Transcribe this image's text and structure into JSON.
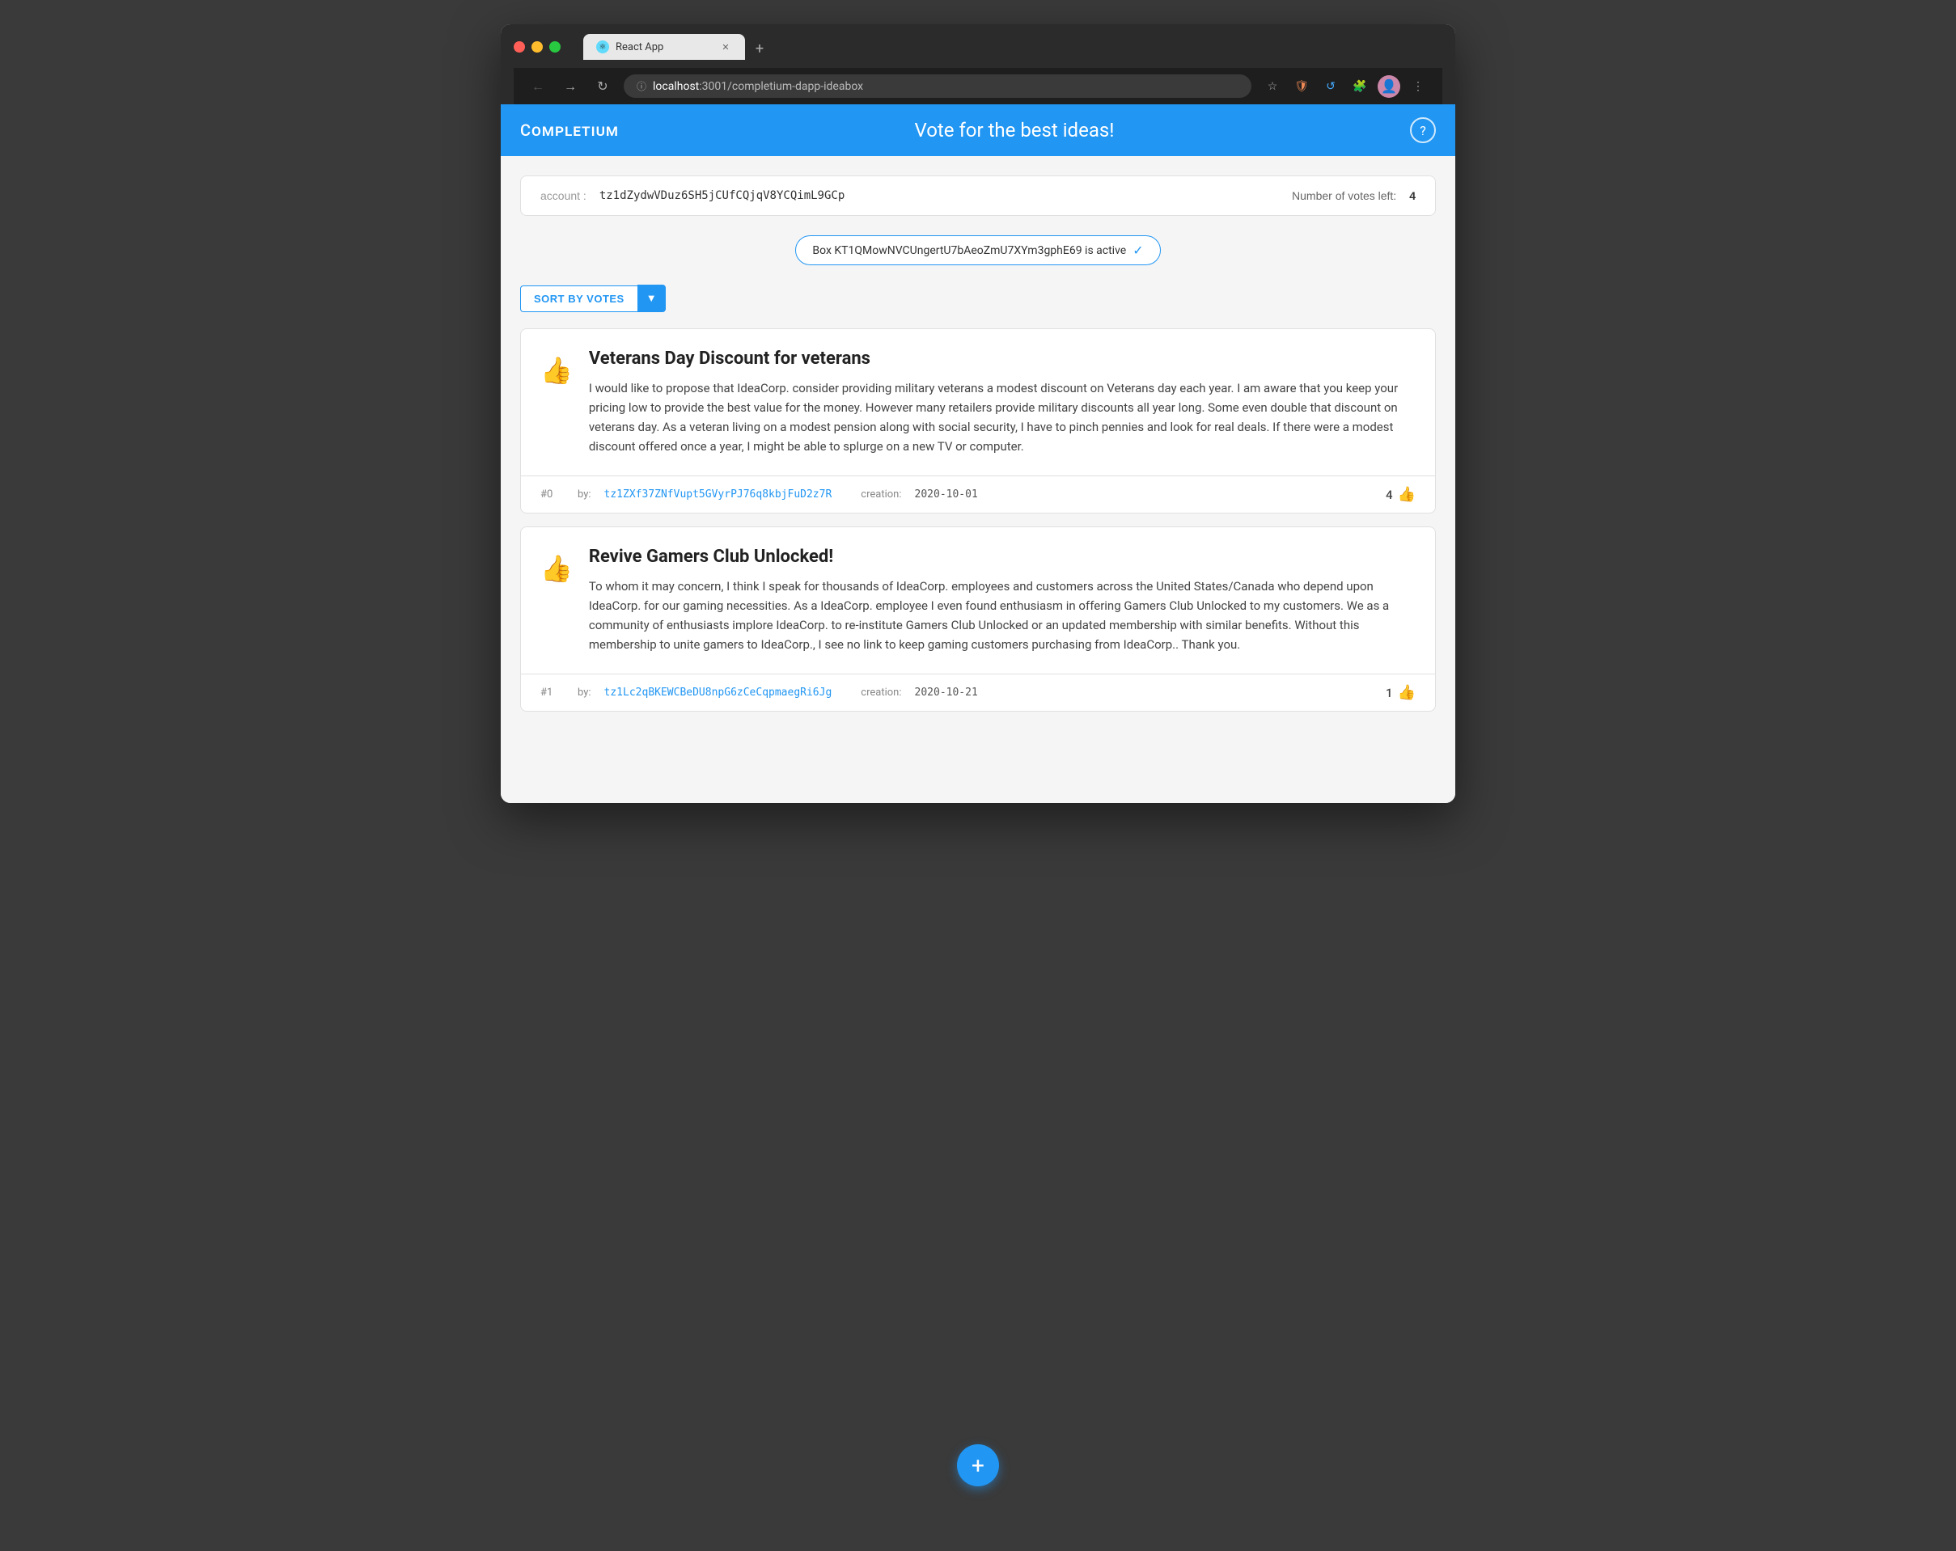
{
  "browser": {
    "tab_title": "React App",
    "tab_favicon": "⚛",
    "address": {
      "domain": "localhost",
      "port_path": ":3001/completium-dapp-ideabox"
    },
    "nav": {
      "back_label": "←",
      "forward_label": "→",
      "refresh_label": "↻",
      "new_tab_label": "+"
    }
  },
  "header": {
    "logo": "Completium",
    "title": "Vote for the best ideas!",
    "help_label": "?"
  },
  "account": {
    "label": "account :",
    "address": "tz1dZydwVDuz6SH5jCUfCQjqV8YCQimL9GCp",
    "votes_label": "Number of votes left:",
    "votes_count": "4"
  },
  "active_box": {
    "text": "Box KT1QMowNVCUngertU7bAeoZmU7XYm3gphE69 is active",
    "check": "✓"
  },
  "sort": {
    "button_label": "SORT BY VOTES",
    "dropdown_label": "▼"
  },
  "ideas": [
    {
      "index": "#0",
      "title": "Veterans Day Discount for veterans",
      "text": "I would like to propose that IdeaCorp. consider providing military veterans a modest discount on Veterans day each year. I am aware that you keep your pricing low to provide the best value for the money. However many retailers provide military discounts all year long. Some even double that discount on veterans day. As a veteran living on a modest pension along with social security, I have to pinch pennies and look for real deals. If there were a modest discount offered once a year, I might be able to splurge on a new TV or computer.",
      "author": "tz1ZXf37ZNfVupt5GVyrPJ76q8kbjFuD2z7R",
      "creation_label": "creation:",
      "creation_date": "2020-10-01",
      "votes": "4",
      "by_label": "by:"
    },
    {
      "index": "#1",
      "title": "Revive Gamers Club Unlocked!",
      "text": "To whom it may concern, I think I speak for thousands of IdeaCorp. employees and customers across the United States/Canada who depend upon IdeaCorp. for our gaming necessities. As a IdeaCorp. employee I even found enthusiasm in offering Gamers Club Unlocked to my customers. We as a community of enthusiasts implore IdeaCorp. to re-institute Gamers Club Unlocked or an updated membership with similar benefits. Without this membership to unite gamers to IdeaCorp., I see no link to keep gaming customers purchasing from IdeaCorp.. Thank you.",
      "author": "tz1Lc2qBKEWCBeDU8npG6zCeCqpmaegRi6Jg",
      "creation_label": "creation:",
      "creation_date": "2020-10-21",
      "votes": "1",
      "by_label": "by:"
    }
  ],
  "fab": {
    "label": "+"
  }
}
